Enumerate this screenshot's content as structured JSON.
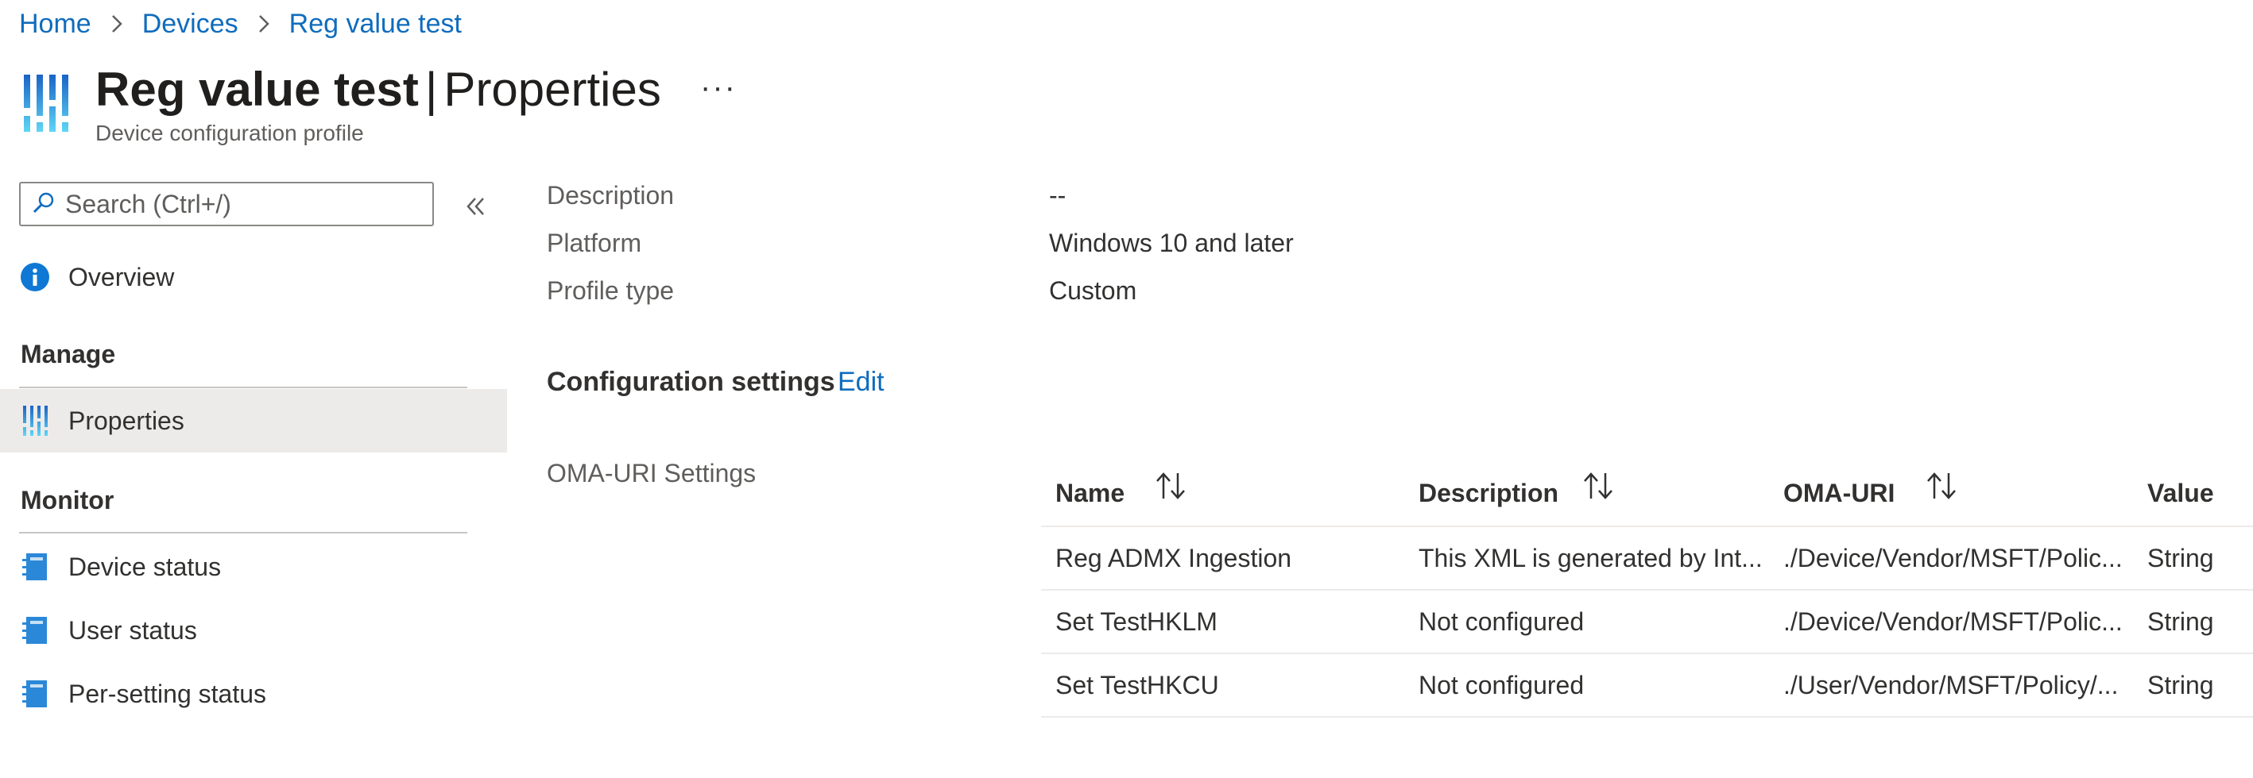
{
  "breadcrumb": [
    {
      "label": "Home"
    },
    {
      "label": "Devices"
    },
    {
      "label": "Reg value test"
    }
  ],
  "header": {
    "title_main": "Reg value test",
    "title_sep": "|",
    "title_section": "Properties",
    "subtitle": "Device configuration profile",
    "more_label": "···"
  },
  "sidebar": {
    "search_placeholder": "Search (Ctrl+/)",
    "overview_label": "Overview",
    "manage_header": "Manage",
    "properties_label": "Properties",
    "monitor_header": "Monitor",
    "monitor_items": [
      "Device status",
      "User status",
      "Per-setting status"
    ]
  },
  "properties": {
    "rows": [
      {
        "label": "Description",
        "value": "--"
      },
      {
        "label": "Platform",
        "value": "Windows 10 and later"
      },
      {
        "label": "Profile type",
        "value": "Custom"
      }
    ],
    "config_title": "Configuration settings",
    "edit_label": "Edit",
    "oma_label": "OMA-URI Settings"
  },
  "table": {
    "headers": [
      "Name",
      "Description",
      "OMA-URI",
      "Value"
    ],
    "rows": [
      [
        "Reg ADMX Ingestion",
        "This XML is generated by Int...",
        "./Device/Vendor/MSFT/Polic...",
        "String"
      ],
      [
        "Set TestHKLM",
        "Not configured",
        "./Device/Vendor/MSFT/Polic...",
        "String"
      ],
      [
        "Set TestHKCU",
        "Not configured",
        "./User/Vendor/MSFT/Policy/...",
        "String"
      ]
    ]
  },
  "colors": {
    "link": "#0f6cbd",
    "selected_bg": "#edebe9",
    "info_icon": "#0f78d4",
    "status_icon": "#2b88d8"
  }
}
